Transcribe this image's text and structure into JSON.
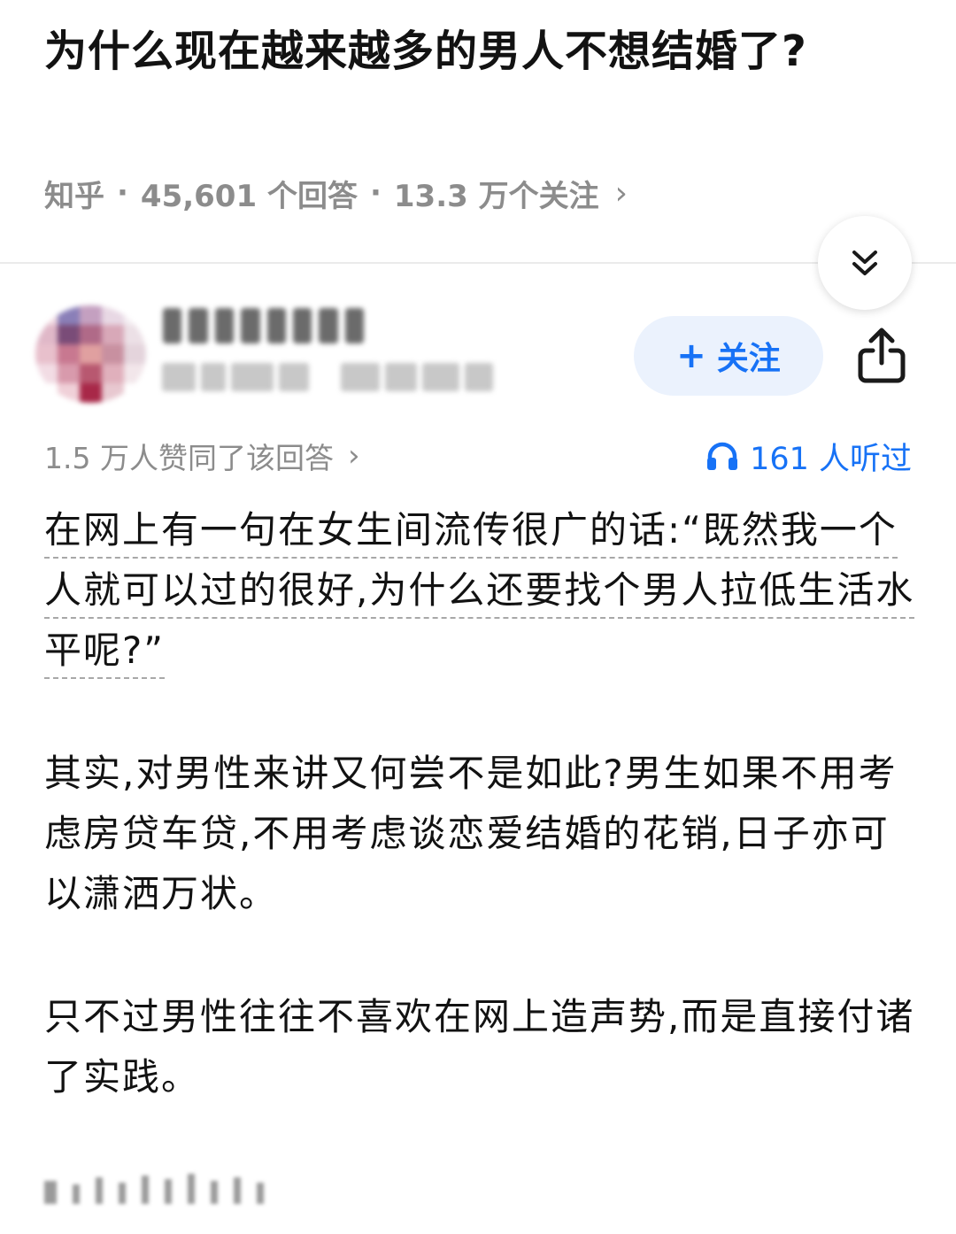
{
  "question": {
    "title": "为什么现在越来越多的男人不想结婚了?",
    "source": "知乎",
    "separator": "·",
    "answers": "45,601 个回答",
    "followers": "13.3 万个关注",
    "chevron": "›"
  },
  "author": {
    "follow_label": "关注",
    "follow_plus": "+"
  },
  "answer": {
    "likes_text": "1.5 万人赞同了该回答",
    "likes_chevron": "›",
    "listened_text": "161 人听过",
    "paragraphs": [
      "在网上有一句在女生间流传很广的话:“既然我一个人就可以过的很好,为什么还要找个男人拉低生活水平呢?”",
      "其实,对男性来讲又何尝不是如此?男生如果不用考虑房贷车贷,不用考虑谈恋爱结婚的花销,日子亦可以潇洒万状。",
      "只不过男性往往不喜欢在网上造声势,而是直接付诸了实践。"
    ]
  },
  "icons": {
    "collapse": "double-chevron-down-icon",
    "share": "share-icon",
    "listen": "headphones-icon"
  },
  "colors": {
    "accent": "#1772f6",
    "follow_bg": "#ebf2fd",
    "meta_gray": "#8c8c8c",
    "text": "#121212"
  }
}
